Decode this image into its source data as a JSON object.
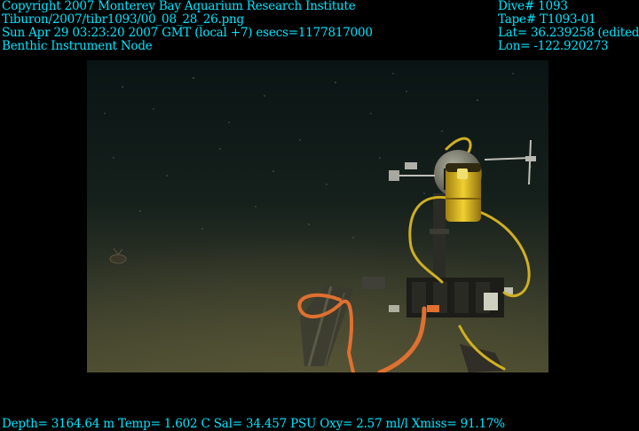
{
  "overlay_top_left": {
    "copyright": "Copyright 2007 Monterey Bay Aquarium Research Institute",
    "file_path": "Tiburon/2007/tibr1093/00_08_28_26.png",
    "timestamp": "Sun Apr 29 03:23:20 2007 GMT (local +7)  esecs=1177817000",
    "subject": "Benthic Instrument Node"
  },
  "overlay_top_right": {
    "dive": "Dive# 1093",
    "tape": "Tape# T1093-01",
    "lat": "Lat= 36.239258 (edited)",
    "lon": "Lon= -122.920273"
  },
  "overlay_bottom": {
    "telemetry": "Depth= 3164.64 m  Temp= 1.602 C  Sal= 34.457 PSU  Oxy= 2.57 ml/l  Xmiss= 91.17%"
  },
  "colors": {
    "overlay_text": "#00e5ff",
    "background": "#000000",
    "seafloor": "#4a4a30",
    "instrument_yellow": "#e8c020",
    "cable_orange": "#e07030"
  }
}
